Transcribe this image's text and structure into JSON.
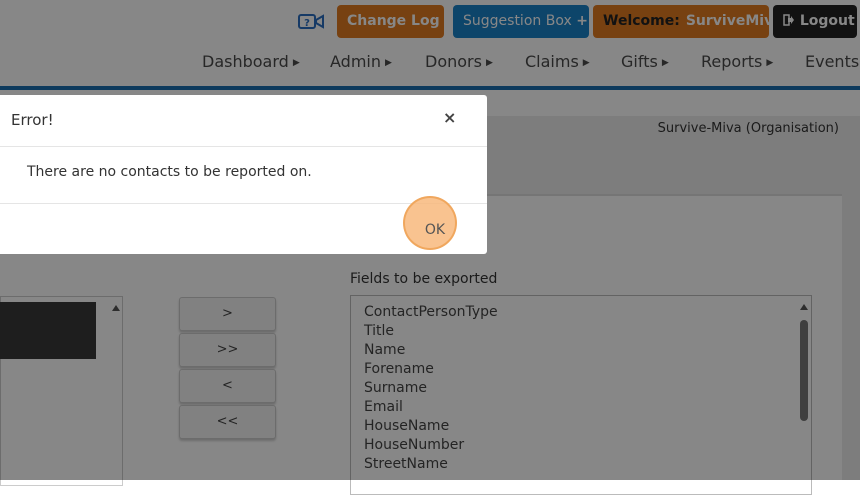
{
  "header": {
    "video_icon": "video-camera-help-icon",
    "change_log_label": "Change Log",
    "change_log_icon": "!",
    "suggestion_label": "Suggestion Box",
    "suggestion_icon": "+",
    "welcome_prefix": "Welcome:",
    "welcome_user": "SurviveMiva",
    "logout_label": "Logout",
    "logout_icon": "sign-out-icon"
  },
  "nav": {
    "items": [
      {
        "label": "Dashboard"
      },
      {
        "label": "Admin"
      },
      {
        "label": "Donors"
      },
      {
        "label": "Claims"
      },
      {
        "label": "Gifts"
      },
      {
        "label": "Reports"
      },
      {
        "label": "Events"
      }
    ]
  },
  "org_label": "Survive-Miva (Organisation)",
  "transfer_buttons": {
    "add": ">",
    "add_all": ">>",
    "remove": "<",
    "remove_all": "<<"
  },
  "fields_label": "Fields to be exported",
  "fields": [
    "ContactPersonType",
    "Title",
    "Name",
    "Forename",
    "Surname",
    "Email",
    "HouseName",
    "HouseNumber",
    "StreetName"
  ],
  "modal": {
    "title": "Error!",
    "close": "×",
    "message": "There are no contacts to be reported on.",
    "ok_label": "OK"
  },
  "colors": {
    "orange": "#e07b20",
    "blue": "#1a82c8",
    "dark": "#222222",
    "nav_line": "#1a6fb0"
  }
}
